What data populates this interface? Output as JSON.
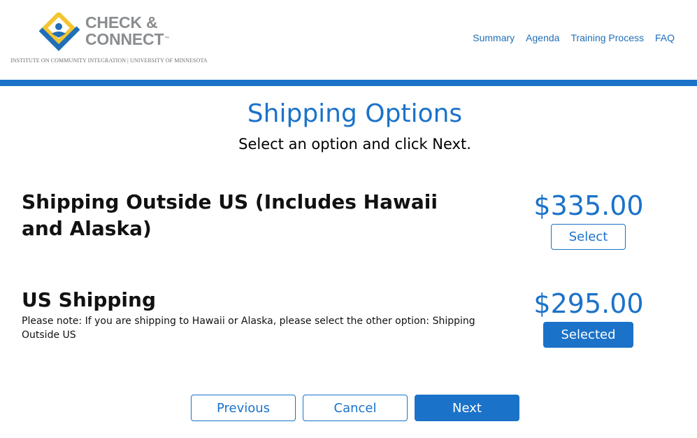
{
  "brand": {
    "name_line1": "CHECK &",
    "name_line2": "CONNECT",
    "trademark": "™",
    "subline": "INSTITUTE ON COMMUNITY INTEGRATION | UNIVERSITY OF MINNESOTA"
  },
  "nav": {
    "items": [
      {
        "label": "Summary"
      },
      {
        "label": "Agenda"
      },
      {
        "label": "Training Process"
      },
      {
        "label": "FAQ"
      }
    ]
  },
  "colors": {
    "accent": "#1b72c9",
    "logo_gray": "#8a8d90",
    "logo_yellow": "#f4c430"
  },
  "page": {
    "title": "Shipping Options",
    "subtitle": "Select an option and click Next."
  },
  "options": [
    {
      "title": "Shipping Outside US (Includes Hawaii and Alaska)",
      "note": "",
      "price": "$335.00",
      "button_label": "Select",
      "selected": false
    },
    {
      "title": "US Shipping",
      "note": "Please note: If you are shipping to Hawaii or Alaska, please select the other option: Shipping Outside US",
      "price": "$295.00",
      "button_label": "Selected",
      "selected": true
    }
  ],
  "actions": {
    "previous_label": "Previous",
    "cancel_label": "Cancel",
    "next_label": "Next"
  }
}
